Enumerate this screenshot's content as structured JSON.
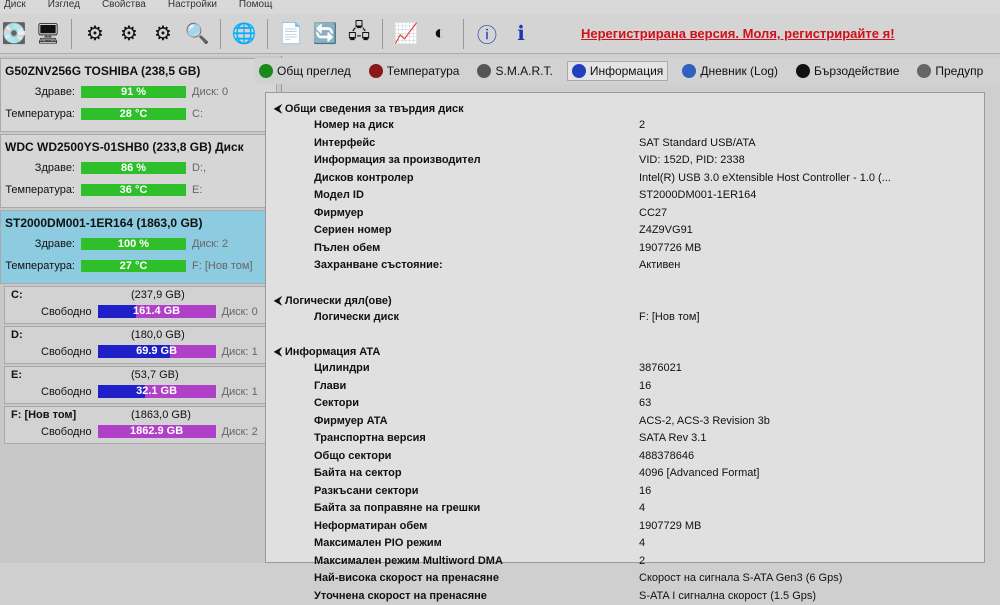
{
  "menu": [
    "Диск",
    "Изглед",
    "Свойства",
    "Настройки",
    "Помощ"
  ],
  "toolbar": {
    "unregistered": "Нерегистрирана версия. Моля, регистрирайте я!"
  },
  "disks": [
    {
      "name": "G50ZNV256G TOSHIBA (238,5 GB)",
      "health_label": "Здраве:",
      "health": "91 %",
      "health_pct": 91,
      "temp_label": "Температура:",
      "temp": "28 °C",
      "ext1": "Диск: 0",
      "ext2": "C:"
    },
    {
      "name": "WDC WD2500YS-01SHB0 (233,8 GB) Диск",
      "health_label": "Здраве:",
      "health": "86 %",
      "health_pct": 86,
      "temp_label": "Температура:",
      "temp": "36 °C",
      "ext1": "D:,",
      "ext2": "E:"
    },
    {
      "name": "ST2000DM001-1ER164 (1863,0 GB)",
      "health_label": "Здраве:",
      "health": "100 %",
      "health_pct": 100,
      "temp_label": "Температура:",
      "temp": "27 °C",
      "ext1": "Диск: 2",
      "ext2": "F: [Нов том]"
    }
  ],
  "volumes": [
    {
      "name": "C:",
      "size": "(237,9 GB)",
      "free_label": "Свободно",
      "free": "161.4 GB",
      "free_pct": 68,
      "disk": "Диск: 0"
    },
    {
      "name": "D:",
      "size": "(180,0 GB)",
      "free_label": "Свободно",
      "free": "69.9 GB",
      "free_pct": 39,
      "disk": "Диск: 1"
    },
    {
      "name": "E:",
      "size": "(53,7 GB)",
      "free_label": "Свободно",
      "free": "32.1 GB",
      "free_pct": 60,
      "disk": "Диск: 1"
    },
    {
      "name": "F: [Нов том]",
      "size": "(1863,0 GB)",
      "free_label": "Свободно",
      "free": "1862.9 GB",
      "free_pct": 100,
      "disk": "Диск: 2"
    }
  ],
  "tabs": [
    {
      "label": "Общ преглед",
      "color": "#1a8a1a",
      "active": false
    },
    {
      "label": "Температура",
      "color": "#8a1a1a",
      "active": false
    },
    {
      "label": "S.M.A.R.T.",
      "color": "#555",
      "active": false
    },
    {
      "label": "Информация",
      "color": "#2040c0",
      "active": true
    },
    {
      "label": "Дневник (Log)",
      "color": "#3060c0",
      "active": false
    },
    {
      "label": "Бързодействие",
      "color": "#111",
      "active": false
    },
    {
      "label": "Предупр",
      "color": "#666",
      "active": false
    }
  ],
  "sections": [
    {
      "title": "Общи сведения за твърдия диск",
      "rows": [
        [
          "Номер на диск",
          "2"
        ],
        [
          "Интерфейс",
          "SAT Standard USB/ATA"
        ],
        [
          "Информация за производител",
          "VID: 152D, PID: 2338"
        ],
        [
          "Дисков контролер",
          "Intel(R) USB 3.0 eXtensible Host Controller - 1.0 (..."
        ],
        [
          "Модел ID",
          "ST2000DM001-1ER164"
        ],
        [
          "Фирмуер",
          "CC27"
        ],
        [
          "Сериен номер",
          "Z4Z9VG91"
        ],
        [
          "Пълен обем",
          "1907726 MB"
        ],
        [
          "Захранване състояние:",
          "Активен"
        ]
      ]
    },
    {
      "title": "Логически дял(ове)",
      "rows": [
        [
          "Логически диск",
          "F: [Нов том]"
        ]
      ]
    },
    {
      "title": "Информация ATA",
      "rows": [
        [
          "Цилиндри",
          "3876021"
        ],
        [
          "Глави",
          "16"
        ],
        [
          "Сектори",
          "63"
        ],
        [
          "Фирмуер ATA",
          "ACS-2, ACS-3 Revision 3b"
        ],
        [
          "Транспортна версия",
          "SATA Rev 3.1"
        ],
        [
          "Общо сектори",
          "488378646"
        ],
        [
          "Байта на сектор",
          "4096 [Advanced Format]"
        ],
        [
          "Разкъсани сектори",
          "16"
        ],
        [
          "Байта за поправяне на грешки",
          "4"
        ],
        [
          "Неформатиран обем",
          "1907729 MB"
        ],
        [
          "Максимален PIO режим",
          "4"
        ],
        [
          "Максимален режим Multiword DMA",
          "2"
        ],
        [
          "Най-висока скорост на пренасяне",
          "Скорост на сигнала S-ATA Gen3 (6 Gps)"
        ],
        [
          "Уточнена скорост на пренасяне",
          "S-ATA I сигнална скорост (1.5 Gps)"
        ]
      ]
    }
  ]
}
